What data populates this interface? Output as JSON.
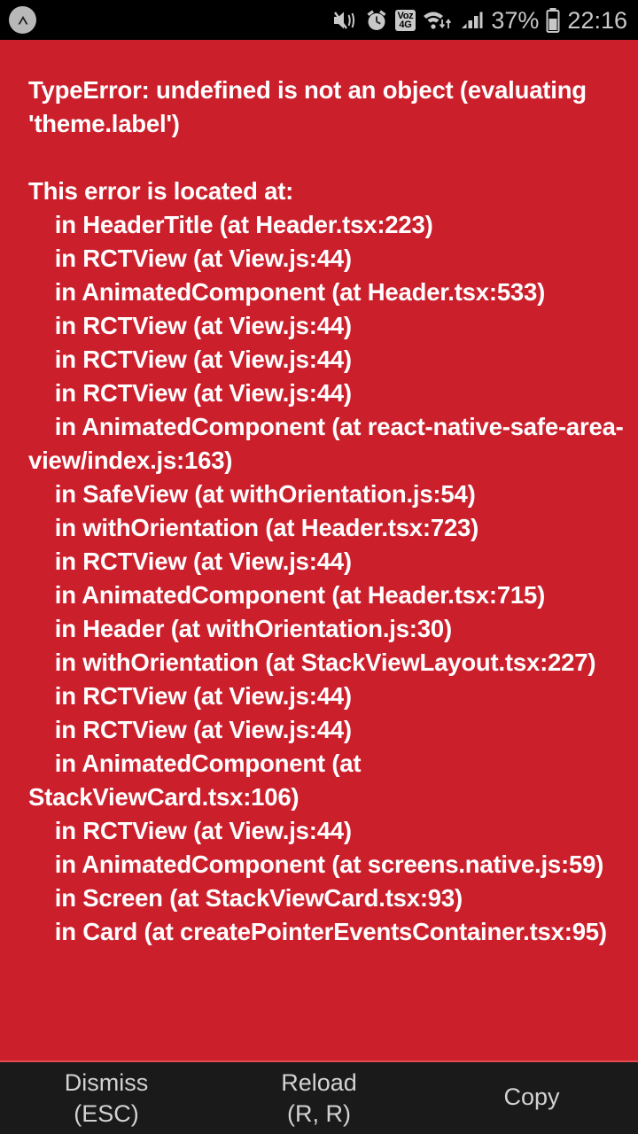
{
  "statusbar": {
    "app_icon": "expo-caret-circle-icon",
    "icons": [
      {
        "name": "mute-vibrate-icon"
      },
      {
        "name": "alarm-clock-icon"
      },
      {
        "name": "voz-4g-icon",
        "line1": "Voz",
        "line2": "4G"
      },
      {
        "name": "wifi-data-transfer-icon"
      },
      {
        "name": "cellular-signal-icon"
      }
    ],
    "battery_percent": "37%",
    "battery_icon": "battery-icon",
    "clock": "22:16"
  },
  "error": {
    "lines": [
      "TypeError: undefined is not an object (evaluating 'theme.label')",
      "",
      "This error is located at:",
      "    in HeaderTitle (at Header.tsx:223)",
      "    in RCTView (at View.js:44)",
      "    in AnimatedComponent (at Header.tsx:533)",
      "    in RCTView (at View.js:44)",
      "    in RCTView (at View.js:44)",
      "    in RCTView (at View.js:44)",
      "    in AnimatedComponent (at react-native-safe-area-view/index.js:163)",
      "    in SafeView (at withOrientation.js:54)",
      "    in withOrientation (at Header.tsx:723)",
      "    in RCTView (at View.js:44)",
      "    in AnimatedComponent (at Header.tsx:715)",
      "    in Header (at withOrientation.js:30)",
      "    in withOrientation (at StackViewLayout.tsx:227)",
      "    in RCTView (at View.js:44)",
      "    in RCTView (at View.js:44)",
      "    in AnimatedComponent (at StackViewCard.tsx:106)",
      "    in RCTView (at View.js:44)",
      "    in AnimatedComponent (at screens.native.js:59)",
      "    in Screen (at StackViewCard.tsx:93)",
      "    in Card (at createPointerEventsContainer.tsx:95)"
    ]
  },
  "buttons": [
    {
      "name": "dismiss-button",
      "label": "Dismiss",
      "shortcut": "(ESC)"
    },
    {
      "name": "reload-button",
      "label": "Reload",
      "shortcut": "(R, R)"
    },
    {
      "name": "copy-button",
      "label": "Copy",
      "shortcut": ""
    }
  ],
  "colors": {
    "redbox": "#cc1f2c",
    "statusbar": "#000000",
    "buttonbar": "#1a1a1a",
    "text": "#ffffff",
    "button_text": "#d2d2d2"
  }
}
